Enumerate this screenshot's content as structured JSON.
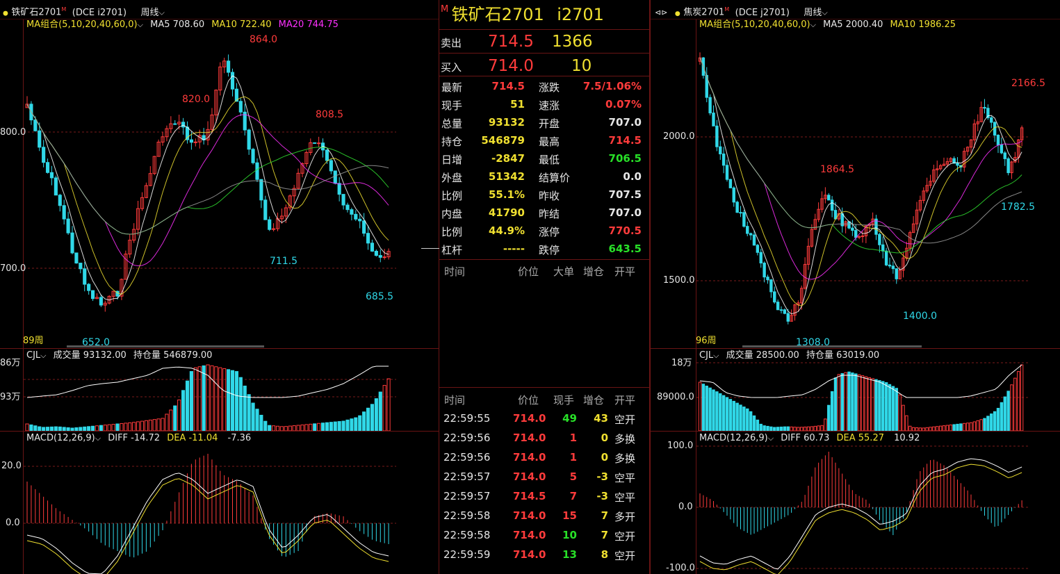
{
  "left": {
    "title": "铁矿石2701",
    "title_mark": "M",
    "exchange": "(DCE  i2701)",
    "period": "周线",
    "ma_label": "MA组合(5,10,20,40,60,0)",
    "ma5": "MA5 708.60",
    "ma10": "MA10 722.40",
    "ma20": "MA20 744.75",
    "y_ticks": [
      "800.0",
      "700.0"
    ],
    "peak_labels": [
      "864.0",
      "820.0",
      "808.5"
    ],
    "trough_labels": [
      "711.5",
      "685.5",
      "652.0"
    ],
    "bars_count": "89周",
    "vol_label": "CJL",
    "vol_value": "成交量 93132.00",
    "oi_value": "持仓量 546879.00",
    "vol_ticks": [
      "86万",
      "93万"
    ],
    "macd_label": "MACD(12,26,9)",
    "diff": "DIFF -14.72",
    "dea": "DEA -11.04",
    "macd": "-7.36",
    "macd_ticks": [
      "20.0",
      "0.0"
    ]
  },
  "quote": {
    "mark": "M",
    "name": "铁矿石2701",
    "code": "i2701",
    "sell_label": "卖出",
    "sell_price": "714.5",
    "sell_vol": "1366",
    "buy_label": "买入",
    "buy_price": "714.0",
    "buy_vol": "10",
    "stats_left": [
      {
        "k": "最新",
        "v": "714.5",
        "c": "red"
      },
      {
        "k": "现手",
        "v": "51",
        "c": "yel"
      },
      {
        "k": "总量",
        "v": "93132",
        "c": "yel"
      },
      {
        "k": "持仓",
        "v": "546879",
        "c": "yel"
      },
      {
        "k": "日增",
        "v": "-2847",
        "c": "yel"
      },
      {
        "k": "外盘",
        "v": "51342",
        "c": "yel"
      },
      {
        "k": "比例",
        "v": "55.1%",
        "c": "yel"
      },
      {
        "k": "内盘",
        "v": "41790",
        "c": "yel"
      },
      {
        "k": "比例",
        "v": "44.9%",
        "c": "yel"
      },
      {
        "k": "杠杆",
        "v": "-----",
        "c": "yel"
      }
    ],
    "stats_right": [
      {
        "k": "涨跌",
        "v": "7.5/1.06%",
        "c": "red"
      },
      {
        "k": "速涨",
        "v": "0.07%",
        "c": "red"
      },
      {
        "k": "开盘",
        "v": "707.0",
        "c": "wht"
      },
      {
        "k": "最高",
        "v": "714.5",
        "c": "red"
      },
      {
        "k": "最低",
        "v": "706.5",
        "c": "grn"
      },
      {
        "k": "结算价",
        "v": "0.0",
        "c": "wht"
      },
      {
        "k": "昨收",
        "v": "707.5",
        "c": "wht"
      },
      {
        "k": "昨结",
        "v": "707.0",
        "c": "wht"
      },
      {
        "k": "涨停",
        "v": "770.5",
        "c": "red"
      },
      {
        "k": "跌停",
        "v": "643.5",
        "c": "grn"
      }
    ],
    "big_header": [
      "时间",
      "价位",
      "大单",
      "增仓",
      "开平"
    ],
    "tick_header": [
      "时间",
      "价位",
      "现手",
      "增仓",
      "开平"
    ],
    "ticks": [
      {
        "time": "22:59:55",
        "price": "714.0",
        "vol": "49",
        "vc": "grn",
        "oi": "43",
        "type": "空开"
      },
      {
        "time": "22:59:56",
        "price": "714.0",
        "vol": "1",
        "vc": "red",
        "oi": "0",
        "type": "多换"
      },
      {
        "time": "22:59:56",
        "price": "714.0",
        "vol": "1",
        "vc": "red",
        "oi": "0",
        "type": "多换"
      },
      {
        "time": "22:59:57",
        "price": "714.0",
        "vol": "5",
        "vc": "red",
        "oi": "-3",
        "type": "空平"
      },
      {
        "time": "22:59:57",
        "price": "714.5",
        "vol": "7",
        "vc": "red",
        "oi": "-3",
        "type": "空平"
      },
      {
        "time": "22:59:58",
        "price": "714.0",
        "vol": "15",
        "vc": "red",
        "oi": "7",
        "type": "多开"
      },
      {
        "time": "22:59:58",
        "price": "714.0",
        "vol": "10",
        "vc": "grn",
        "oi": "7",
        "type": "空开"
      },
      {
        "time": "22:59:59",
        "price": "714.0",
        "vol": "13",
        "vc": "grn",
        "oi": "8",
        "type": "空开"
      }
    ]
  },
  "right": {
    "title": "焦炭2701",
    "title_mark": "M",
    "exchange": "(DCE  j2701)",
    "period": "周线",
    "ma_label": "MA组合(5,10,20,40,60,0)",
    "ma5": "MA5 2000.40",
    "ma10": "MA10 1986.25",
    "y_ticks": [
      "2000.0",
      "1500.0"
    ],
    "peak_labels": [
      "2166.5",
      "1864.5"
    ],
    "trough_labels": [
      "1782.5",
      "1400.0",
      "1308.0"
    ],
    "bars_count": "96周",
    "vol_label": "CJL",
    "vol_value": "成交量 28500.00",
    "oi_value": "持仓量 63019.00",
    "vol_ticks": [
      "18万",
      "89000.0"
    ],
    "macd_label": "MACD(12,26,9)",
    "diff": "DIFF 60.73",
    "dea": "DEA 55.27",
    "macd": "10.92",
    "macd_ticks": [
      "100.0",
      "0.0",
      "-100.0"
    ]
  },
  "colors": {
    "up": "#ff3b3b",
    "down": "#30d8e8",
    "grid": "#7a1a1a"
  }
}
